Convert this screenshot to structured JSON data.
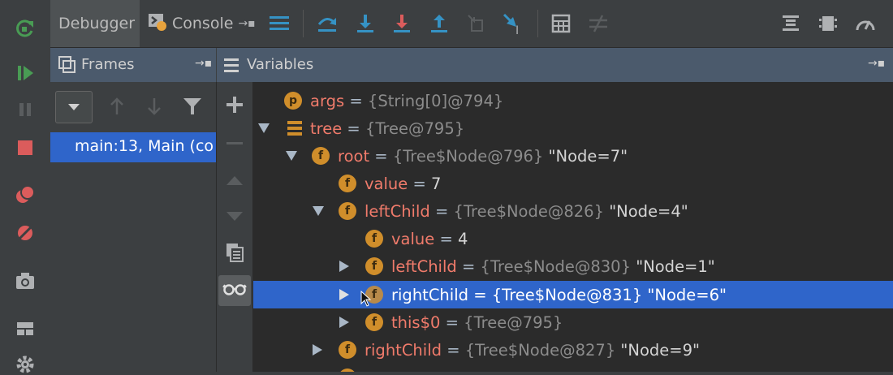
{
  "toolbar": {
    "tabs": [
      {
        "label": "Debugger"
      },
      {
        "label": "Console"
      }
    ]
  },
  "panels": {
    "frames_title": "Frames",
    "variables_title": "Variables",
    "frame_item": "main:13, Main (co"
  },
  "variables": [
    {
      "badge": "p",
      "name": "args",
      "eq": " = ",
      "obj": "{String[0]@794}",
      "extra": ""
    },
    {
      "badge": "",
      "name": "tree",
      "eq": " = ",
      "obj": "{Tree@795}",
      "extra": ""
    },
    {
      "badge": "f",
      "name": "root",
      "eq": " = ",
      "obj": "{Tree$Node@796}",
      "extra": " \"Node=7\""
    },
    {
      "badge": "f",
      "name": "value",
      "eq": " = ",
      "obj": "",
      "extra": "7"
    },
    {
      "badge": "f",
      "name": "leftChild",
      "eq": " = ",
      "obj": "{Tree$Node@826}",
      "extra": " \"Node=4\""
    },
    {
      "badge": "f",
      "name": "value",
      "eq": " = ",
      "obj": "",
      "extra": "4"
    },
    {
      "badge": "f",
      "name": "leftChild",
      "eq": " = ",
      "obj": "{Tree$Node@830}",
      "extra": " \"Node=1\""
    },
    {
      "badge": "f",
      "name": "rightChild",
      "eq": " = ",
      "obj": "{Tree$Node@831}",
      "extra": " \"Node=6\""
    },
    {
      "badge": "f",
      "name": "this$0",
      "eq": " = ",
      "obj": "{Tree@795}",
      "extra": ""
    },
    {
      "badge": "f",
      "name": "rightChild",
      "eq": " = ",
      "obj": "{Tree$Node@827}",
      "extra": " \"Node=9\""
    }
  ],
  "colors": {
    "accent": "#2f65ca",
    "header": "#4b5a6c",
    "badge": "#d08e2b",
    "name": "#f07b6b"
  }
}
